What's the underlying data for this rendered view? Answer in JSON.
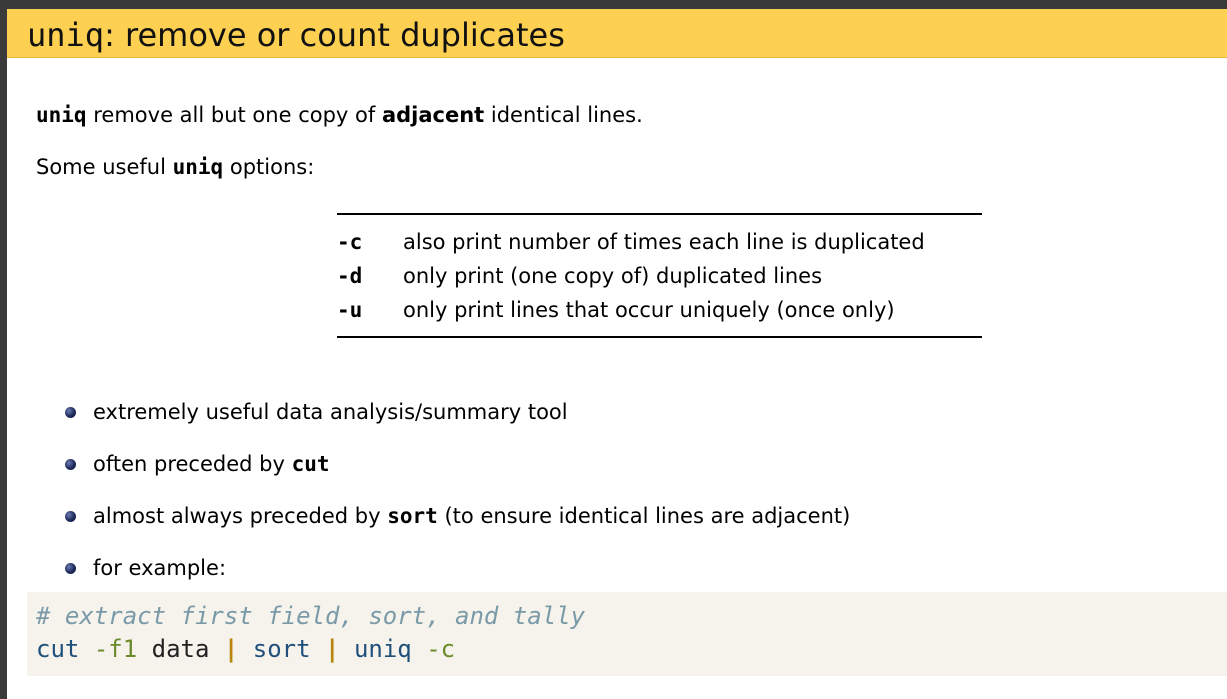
{
  "title": {
    "command": "uniq",
    "rest": ": remove or count duplicates"
  },
  "intro": {
    "cmd": "uniq",
    "before_bold": " remove all but one copy of ",
    "bold": "adjacent",
    "after_bold": " identical lines."
  },
  "options_intro": {
    "before": "Some useful ",
    "cmd": "uniq",
    "after": " options:"
  },
  "options": [
    {
      "flag": "-c",
      "desc": "also print number of times each line is duplicated"
    },
    {
      "flag": "-d",
      "desc": "only print (one copy of) duplicated lines"
    },
    {
      "flag": "-u",
      "desc": "only print lines that occur uniquely (once only)"
    }
  ],
  "bullets": {
    "b1": {
      "text": "extremely useful data analysis/summary tool"
    },
    "b2": {
      "before": "often preceded by ",
      "cmd": "cut"
    },
    "b3": {
      "before": "almost always preceded by ",
      "cmd": "sort",
      "after": " (to ensure identical lines are adjacent)"
    },
    "b4": {
      "text": "for example:"
    }
  },
  "code": {
    "comment": "# extract first field, sort, and tally",
    "cmd1": "cut",
    "arg1": "-f1",
    "word1": "data",
    "pipe": "|",
    "cmd2": "sort",
    "cmd3": "uniq",
    "arg3": "-c"
  },
  "colors": {
    "title_bar": "#fdd052",
    "code_background": "#f6f3ec",
    "comment": "#7a9aa8",
    "command": "#1f4f7a",
    "argument": "#6b8b2a",
    "pipe": "#b8860b"
  }
}
